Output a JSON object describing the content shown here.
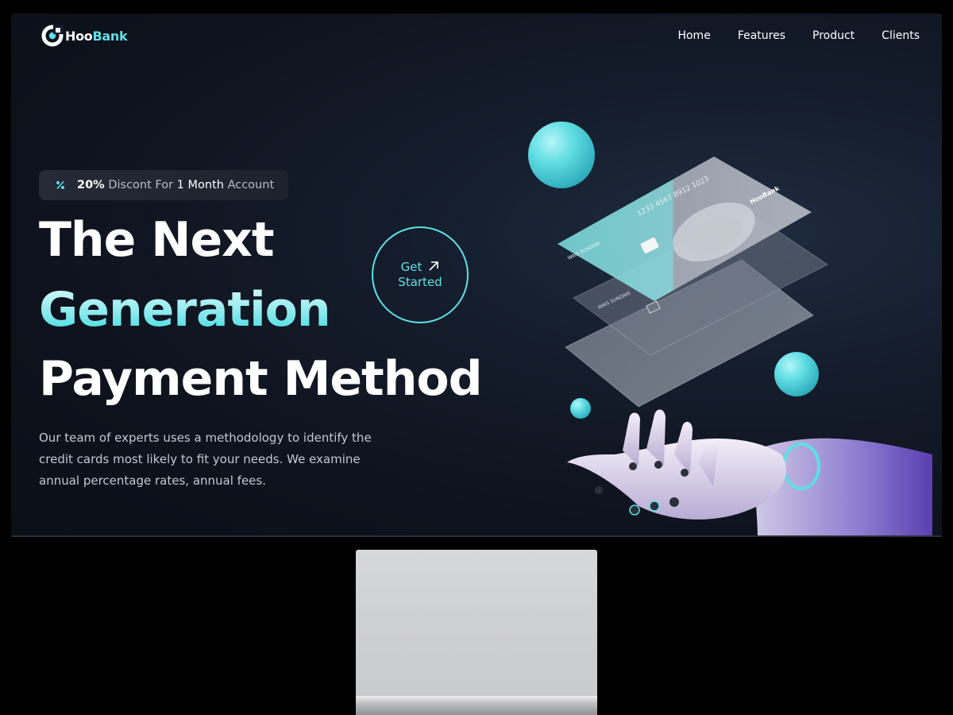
{
  "brand": {
    "name_part1": "Hoo",
    "name_part2": "Bank",
    "accent_color": "#5ce1e6"
  },
  "nav": {
    "items": [
      {
        "label": "Home"
      },
      {
        "label": "Features"
      },
      {
        "label": "Product"
      },
      {
        "label": "Clients"
      }
    ]
  },
  "hero": {
    "badge": {
      "icon": "discount-icon",
      "percent": "20%",
      "text1": "Discont For",
      "months": "1 Month",
      "text2": "Account"
    },
    "headline": {
      "line1": "The Next",
      "line2": "Generation",
      "line3": "Payment Method"
    },
    "description": "Our team of experts uses a methodology to identify the credit cards most likely to fit your needs. We examine annual percentage rates, annual fees.",
    "cta": {
      "line1": "Get",
      "line2": "Started",
      "icon": "arrow-up-right-icon"
    }
  },
  "illustration": {
    "card_number": "1233 4567 8912 1023",
    "card_holder": "WAIS SUNDARI",
    "card_brand": "HooBank"
  }
}
